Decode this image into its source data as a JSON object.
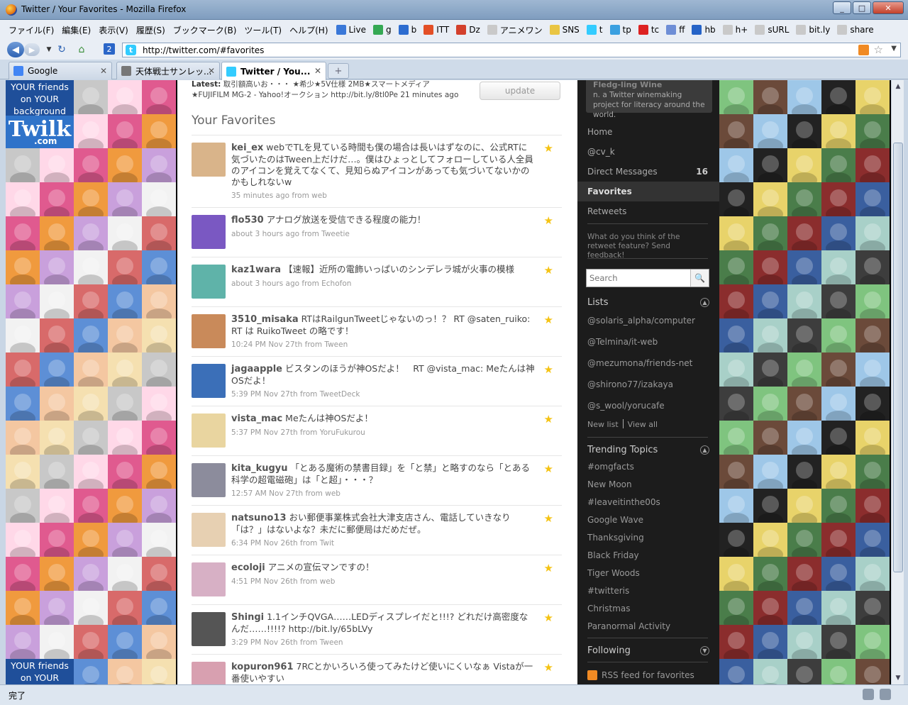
{
  "window": {
    "title": "Twitter / Your Favorites - Mozilla Firefox",
    "minimize": "_",
    "maximize": "□",
    "close": "✕"
  },
  "menu": [
    "ファイル(F)",
    "編集(E)",
    "表示(V)",
    "履歴(S)",
    "ブックマーク(B)",
    "ツール(T)",
    "ヘルプ(H)"
  ],
  "bookmarks": [
    {
      "label": "Live",
      "color": "#3a78d8"
    },
    {
      "label": "g",
      "color": "#34a853"
    },
    {
      "label": "b",
      "color": "#2c6cd0"
    },
    {
      "label": "ITT",
      "color": "#e34f26"
    },
    {
      "label": "Dz",
      "color": "#d3402c"
    },
    {
      "label": "アニメワン",
      "color": "#c9c9c9"
    },
    {
      "label": "SNS",
      "color": "#e9c543"
    },
    {
      "label": "t",
      "color": "#33ccff"
    },
    {
      "label": "tp",
      "color": "#3aa0e0"
    },
    {
      "label": "tc",
      "color": "#d22"
    },
    {
      "label": "ff",
      "color": "#6e8ed6"
    },
    {
      "label": "hb",
      "color": "#2563c7"
    },
    {
      "label": "h+",
      "color": "#c9c9c9"
    },
    {
      "label": "sURL",
      "color": "#c9c9c9"
    },
    {
      "label": "bit.ly",
      "color": "#c9c9c9"
    },
    {
      "label": "share",
      "color": "#c9c9c9"
    }
  ],
  "nav": {
    "url": "http://twitter.com/#favorites",
    "back": "◀",
    "forward": "▶",
    "reload": "↻",
    "home": "⌂",
    "tab_number": "2"
  },
  "tabs": [
    {
      "label": "Google",
      "color": "#4285f4"
    },
    {
      "label": "天体戦士サンレッ...",
      "color": "#777"
    },
    {
      "label": "Twitter / You...",
      "color": "#33ccff"
    }
  ],
  "tab_close": "✕",
  "newtab": "+",
  "twilk": {
    "top_text": "YOUR friends on YOUR background",
    "logo": "Twilk",
    "logo_sub": ".com",
    "bottom_text": "YOUR friends on YOUR"
  },
  "latest": {
    "label": "Latest:",
    "line1": " 取引額高いお・・・ ★希少★5V仕様 2MB★スマートメディア",
    "line2": "★FUJIFILM MG-2 - Yahoo!オークション http://bit.ly/8tl0Pe 21 minutes ago"
  },
  "update_button": "update",
  "page_title": "Your Favorites",
  "statuses": [
    {
      "screen_name": "kei_ex",
      "text": "webでTLを見ている時間も僕の場合は長いはずなのに、公式RTに気づいたのはTween上だけだ…。僕はひょっとしてフォローしている人全員のアイコンを覚えてなくて、見知らぬアイコンがあっても気づいてないかのかもしれないw",
      "meta": "35 minutes ago from web",
      "color": "#d9b48a"
    },
    {
      "screen_name": "flo530",
      "text": "アナログ放送を受信できる程度の能力！",
      "meta": "about 3 hours ago from Tweetie",
      "color": "#7a58c2"
    },
    {
      "screen_name": "kaz1wara",
      "text": "【速報】近所の電飾いっぱいのシンデレラ城が火事の模様",
      "meta": "about 3 hours ago from Echofon",
      "color": "#5fb3a9"
    },
    {
      "screen_name": "3510_misaka",
      "text": "RTはRailgunTweetじゃないのっ！？ RT @saten_ruiko: RT は RuikoTweet の略です！",
      "meta": "10:24 PM Nov 27th from Tween",
      "color": "#c98a5a"
    },
    {
      "screen_name": "jagaapple",
      "text": "ビスタンのほうが神OSだよ！　RT @vista_mac: Meたんは神OSだよ！",
      "meta": "5:39 PM Nov 27th from TweetDeck",
      "color": "#3b6fb8"
    },
    {
      "screen_name": "vista_mac",
      "text": "Meたんは神OSだよ！",
      "meta": "5:37 PM Nov 27th from YoruFukurou",
      "color": "#e9d5a0"
    },
    {
      "screen_name": "kita_kugyu",
      "text": "「とある魔術の禁書目録」を「と禁」と略すのなら「とある科学の超電磁砲」は「と超」・・・？",
      "meta": "12:57 AM Nov 27th from web",
      "color": "#8c8c9c"
    },
    {
      "screen_name": "natsuno13",
      "text": "おい郵便事業株式会社大津支店さん、電話していきなり「は？」はないよな？未だに郵便局はだめだぜ。",
      "meta": "6:34 PM Nov 26th from Twit",
      "color": "#e7d0b2"
    },
    {
      "screen_name": "ecoloji",
      "text": "アニメの宣伝マンですの！",
      "meta": "4:51 PM Nov 26th from web",
      "color": "#d7b0c5"
    },
    {
      "screen_name": "Shingi",
      "text": "1.1インチQVGA……LEDディスプレイだと!!!? どれだけ高密度なんだ……!!!!? http://bit.ly/65bLVy",
      "meta": "3:29 PM Nov 26th from Tween",
      "color": "#555"
    },
    {
      "screen_name": "kopuron961",
      "text": "7RCとかいろいろ使ってみたけど使いにくいなぁ Vistaが一番使いやすい",
      "meta": "",
      "color": "#d8a0b0"
    }
  ],
  "sidebar": {
    "profile_name": "Fledg-ling Wine",
    "profile_desc": "n. a Twitter winemaking project for literacy around the world.",
    "nav": [
      {
        "label": "Home",
        "count": ""
      },
      {
        "label": "@cv_k",
        "count": ""
      },
      {
        "label": "Direct Messages",
        "count": "16"
      },
      {
        "label": "Favorites",
        "count": ""
      },
      {
        "label": "Retweets",
        "count": ""
      }
    ],
    "feedback": "What do you think of the retweet feature? Send feedback!",
    "search_placeholder": "Search",
    "search_button": "🔍",
    "lists_heading": "Lists",
    "lists": [
      "@solaris_alpha/computer",
      "@Telmina/it-web",
      "@mezumona/friends-net",
      "@shirono77/izakaya",
      "@s_wool/yorucafe"
    ],
    "new_list": "New list",
    "view_all": "View all",
    "trending_heading": "Trending Topics",
    "trends": [
      "#omgfacts",
      "New Moon",
      "#leaveitinthe00s",
      "Google Wave",
      "Thanksgiving",
      "Black Friday",
      "Tiger Woods",
      "#twitteris",
      "Christmas",
      "Paranormal Activity"
    ],
    "following_heading": "Following",
    "rss": "RSS feed for favorites",
    "toggle_up": "▲",
    "toggle_down": "▼"
  },
  "status_bar": "完了",
  "scroll": {
    "up": "▲",
    "down": "▼"
  }
}
